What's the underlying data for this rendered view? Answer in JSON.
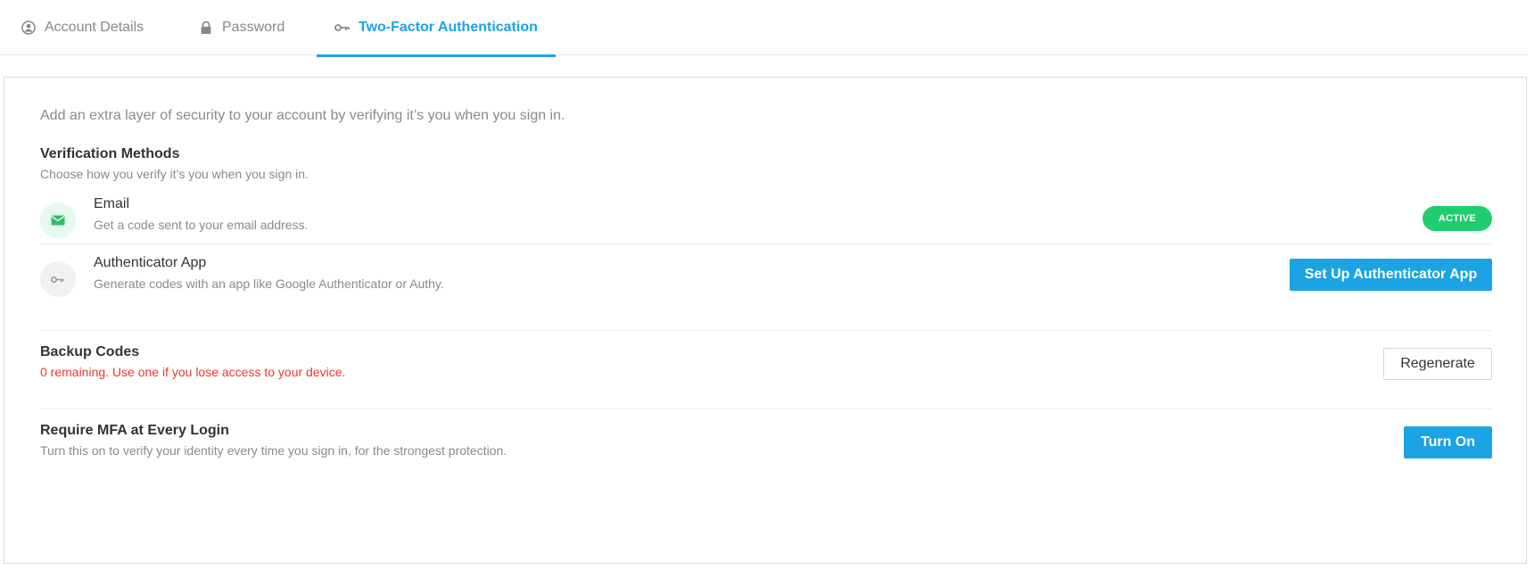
{
  "tabs": [
    {
      "label": "Account Details",
      "icon": "user-circle-icon"
    },
    {
      "label": "Password",
      "icon": "lock-icon"
    },
    {
      "label": "Two-Factor Authentication",
      "icon": "key-icon",
      "active": true
    }
  ],
  "intro": "Add an extra layer of security to your account by verifying it’s you when you sign in.",
  "verification": {
    "title": "Verification Methods",
    "subtitle": "Choose how you verify it’s you when you sign in.",
    "methods": [
      {
        "title": "Email",
        "subtitle": "Get a code sent to your email address.",
        "icon": "envelope-icon",
        "badge": "ACTIVE"
      },
      {
        "title": "Authenticator App",
        "subtitle": "Generate codes with an app like Google Authenticator or Authy.",
        "icon": "key-icon",
        "button": "Set Up Authenticator App"
      }
    ]
  },
  "backup": {
    "title": "Backup Codes",
    "subtitle": "0 remaining. Use one if you lose access to your device.",
    "button": "Regenerate"
  },
  "mfa": {
    "title": "Require MFA at Every Login",
    "subtitle": "Turn this on to verify your identity every time you sign in, for the strongest protection.",
    "button": "Turn On"
  },
  "colors": {
    "accent": "#1ba3e3",
    "active_badge": "#1fce6d",
    "warning_text": "#e53935"
  }
}
